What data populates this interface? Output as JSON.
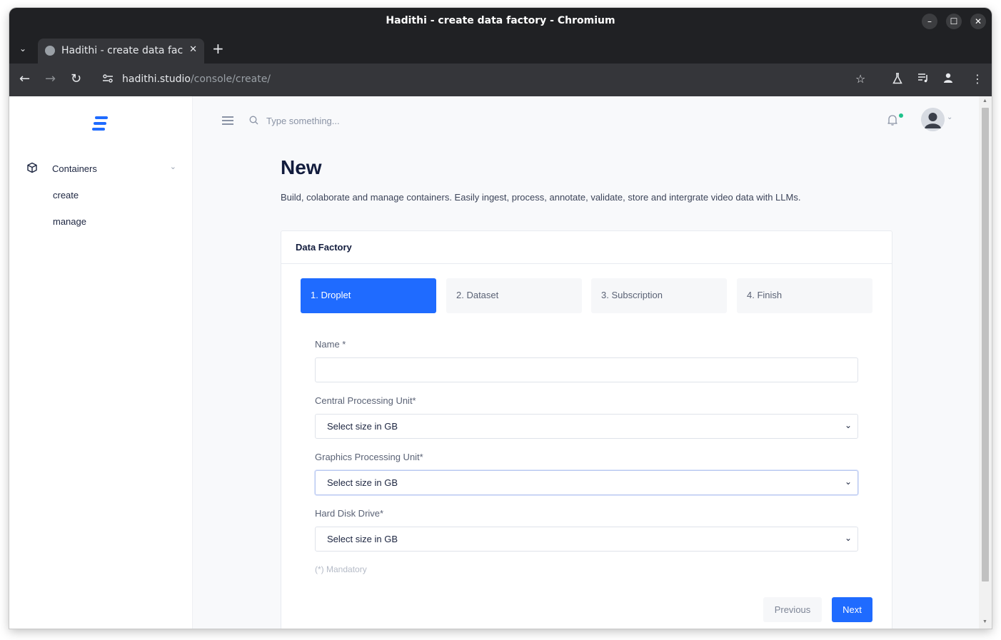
{
  "window": {
    "title": "Hadithi - create data factory - Chromium",
    "minimize": "–",
    "maximize": "☐",
    "close": "✕"
  },
  "tabs": [
    {
      "title": "Hadithi - create data factory",
      "close": "✕"
    }
  ],
  "tabstrip": {
    "dropdown": "⌄",
    "new_tab": "+"
  },
  "toolbar": {
    "back": "←",
    "forward": "→",
    "reload": "↻",
    "url_host": "hadithi.studio",
    "url_path": "/console/create/",
    "bookmark": "☆",
    "menu": "⋮"
  },
  "sidebar": {
    "group_label": "Containers",
    "group_chevron": "⌄",
    "items": [
      {
        "label": "create"
      },
      {
        "label": "manage"
      }
    ]
  },
  "topbar": {
    "search_placeholder": "Type something...",
    "avatar_chevron": "⌄"
  },
  "main": {
    "title": "New",
    "description": "Build, colaborate and manage containers. Easily ingest, process, annotate, validate, store and intergrate video data with LLMs.",
    "card_title": "Data Factory",
    "steps": [
      {
        "label": "1. Droplet",
        "active": true
      },
      {
        "label": "2. Dataset",
        "active": false
      },
      {
        "label": "3. Subscription",
        "active": false
      },
      {
        "label": "4. Finish",
        "active": false
      }
    ],
    "fields": {
      "name": {
        "label": "Name *",
        "value": ""
      },
      "cpu": {
        "label": "Central Processing Unit*",
        "value": "Select size in GB"
      },
      "gpu": {
        "label": "Graphics Processing Unit*",
        "value": "Select size in GB"
      },
      "hdd": {
        "label": "Hard Disk Drive*",
        "value": "Select size in GB"
      }
    },
    "mandatory_note": "(*) Mandatory",
    "previous_label": "Previous",
    "next_label": "Next"
  },
  "colors": {
    "accent": "#1f6bff",
    "notification_dot": "#1ec28b",
    "titlebar": "#202124",
    "toolbar": "#35363a"
  }
}
